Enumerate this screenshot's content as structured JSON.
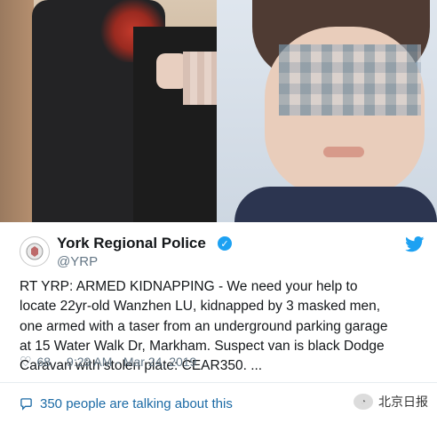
{
  "tweet": {
    "account_name": "York Regional Police",
    "handle": "@YRP",
    "text_lines": [
      "RT YRP: ARMED KIDNAPPING - We need your help to",
      "locate 22yr-old Wanzhen LU, kidnapped by 3 masked men,",
      "one armed with a taser from an underground parking garage",
      "at 15 Water Walk Dr, Markham. Suspect van is black Dodge",
      "Caravan with stolen plate: CEAR350. ..."
    ],
    "likes": "68",
    "timestamp": "9:29 AM - Mar 24, 2019",
    "talking": "350 people are talking about this"
  },
  "watermark": {
    "text": "北京日报"
  },
  "icons": {
    "verified": "verified-badge-icon",
    "twitter": "twitter-bird-icon",
    "heart": "heart-icon",
    "comment": "comment-bubble-icon"
  },
  "colors": {
    "twitter_blue": "#1da1f2",
    "link_blue": "#1b6aa5",
    "muted": "#657786"
  }
}
